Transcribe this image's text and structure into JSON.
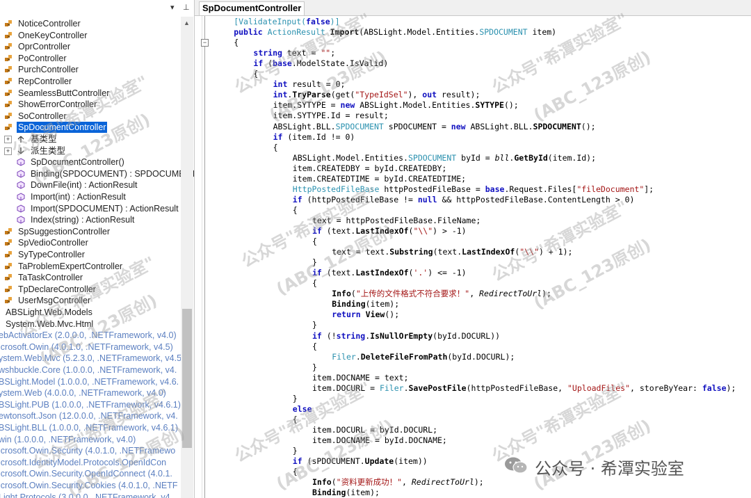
{
  "left_panel": {
    "toolbar": {
      "dropdown": "▾",
      "pin": "⊥"
    },
    "tree": [
      {
        "label": "NoticeController",
        "kind": "class",
        "indent": 0
      },
      {
        "label": "OneKeyController",
        "kind": "class",
        "indent": 0
      },
      {
        "label": "OprController",
        "kind": "class",
        "indent": 0
      },
      {
        "label": "PoController",
        "kind": "class",
        "indent": 0
      },
      {
        "label": "PurchController",
        "kind": "class",
        "indent": 0
      },
      {
        "label": "RepController",
        "kind": "class",
        "indent": 0
      },
      {
        "label": "SeamlessButtController",
        "kind": "class",
        "indent": 0
      },
      {
        "label": "ShowErrorController",
        "kind": "class",
        "indent": 0
      },
      {
        "label": "SoController",
        "kind": "class",
        "indent": 0
      },
      {
        "label": "SpDocumentController",
        "kind": "class",
        "indent": 0,
        "selected": true
      },
      {
        "label": "基类型",
        "kind": "base",
        "indent": 1
      },
      {
        "label": "派生类型",
        "kind": "derived",
        "indent": 1
      },
      {
        "label": "SpDocumentController()",
        "kind": "method",
        "indent": 1
      },
      {
        "label": "Binding(SPDOCUMENT) : SPDOCUMENT",
        "kind": "method",
        "indent": 1
      },
      {
        "label": "DownFile(int) : ActionResult",
        "kind": "method",
        "indent": 1
      },
      {
        "label": "Import(int) : ActionResult",
        "kind": "method",
        "indent": 1
      },
      {
        "label": "Import(SPDOCUMENT) : ActionResult",
        "kind": "method",
        "indent": 1
      },
      {
        "label": "Index(string) : ActionResult",
        "kind": "method",
        "indent": 1
      },
      {
        "label": "SpSuggestionController",
        "kind": "class",
        "indent": 0
      },
      {
        "label": "SpVedioController",
        "kind": "class",
        "indent": 0
      },
      {
        "label": "SyTypeController",
        "kind": "class",
        "indent": 0
      },
      {
        "label": "TaProblemExpertController",
        "kind": "class",
        "indent": 0
      },
      {
        "label": "TaTaskController",
        "kind": "class",
        "indent": 0
      },
      {
        "label": "TpDeclareController",
        "kind": "class",
        "indent": 0
      },
      {
        "label": "UserMsgController",
        "kind": "class",
        "indent": 0
      },
      {
        "label": "ABSLight.Web.Models",
        "kind": "ns",
        "indent": -1
      },
      {
        "label": "System.Web.Mvc.Html",
        "kind": "ns",
        "indent": -1
      },
      {
        "label": "ebActivatorEx (2.0.0.0, .NETFramework, v4.0)",
        "kind": "asm",
        "indent": -2
      },
      {
        "label": "icrosoft.Owin (4.0.1.0, .NETFramework, v4.5)",
        "kind": "asm",
        "indent": -2
      },
      {
        "label": "ystem.Web.Mvc (5.2.3.0, .NETFramework, v4.5",
        "kind": "asm",
        "indent": -2
      },
      {
        "label": "wshbuckle.Core (1.0.0.0, .NETFramework, v4.",
        "kind": "asm",
        "indent": -2
      },
      {
        "label": "BSLight.Model (1.0.0.0, .NETFramework, v4.6.",
        "kind": "asm",
        "indent": -2
      },
      {
        "label": "ystem.Web (4.0.0.0, .NETFramework, v4.0)",
        "kind": "asm",
        "indent": -2
      },
      {
        "label": "BSLight.PUB (1.0.0.0, .NETFramework, v4.6.1)",
        "kind": "asm",
        "indent": -2
      },
      {
        "label": "ewtonsoft.Json (12.0.0.0, .NETFramework, v4.",
        "kind": "asm",
        "indent": -2
      },
      {
        "label": "BSLight.BLL (1.0.0.0, .NETFramework, v4.6.1)",
        "kind": "asm",
        "indent": -2
      },
      {
        "label": "win (1.0.0.0, .NETFramework, v4.0)",
        "kind": "asm",
        "indent": -2
      },
      {
        "label": "icrosoft.Owin.Security (4.0.1.0, .NETFramewo",
        "kind": "asm",
        "indent": -2
      },
      {
        "label": "icrosoft.IdentityModel.Protocols.OpenIdCon",
        "kind": "asm",
        "indent": -2
      },
      {
        "label": "icrosoft.Owin.Security.OpenIdConnect (4.0.1.",
        "kind": "asm",
        "indent": -2
      },
      {
        "label": "icrosoft.Owin.Security.Cookies (4.0.1.0, .NETF",
        "kind": "asm",
        "indent": -2
      },
      {
        "label": "Light.Protocols (3.0.0.0, .NETFramework, v4.",
        "kind": "asm",
        "indent": -2
      }
    ]
  },
  "editor": {
    "tab_title": "SpDocumentController",
    "fold_toggle": "−",
    "lines": [
      {
        "indent": 4,
        "tokens": [
          [
            "at",
            "[ValidateInput("
          ],
          [
            "kw",
            "false"
          ],
          [
            "at",
            ")]"
          ]
        ]
      },
      {
        "indent": 4,
        "tokens": [
          [
            "kw",
            "public "
          ],
          [
            "ty",
            "ActionResult "
          ],
          [
            "mt",
            "Import"
          ],
          [
            "",
            "(ABSLight.Model.Entities."
          ],
          [
            "ty",
            "SPDOCUMENT"
          ],
          [
            "",
            " item)"
          ]
        ]
      },
      {
        "indent": 4,
        "tokens": [
          [
            "",
            "{"
          ]
        ]
      },
      {
        "indent": 8,
        "tokens": [
          [
            "kw",
            "string"
          ],
          [
            "",
            " text = "
          ],
          [
            "st",
            "\"\""
          ],
          [
            "",
            ";"
          ]
        ]
      },
      {
        "indent": 8,
        "tokens": [
          [
            "kw",
            "if"
          ],
          [
            "",
            " ("
          ],
          [
            "kw",
            "base"
          ],
          [
            "",
            ".ModelState.IsValid)"
          ]
        ]
      },
      {
        "indent": 8,
        "tokens": [
          [
            "",
            "{"
          ]
        ]
      },
      {
        "indent": 12,
        "tokens": [
          [
            "kw",
            "int"
          ],
          [
            "",
            " result = 0;"
          ]
        ]
      },
      {
        "indent": 12,
        "tokens": [
          [
            "kw",
            "int"
          ],
          [
            "",
            "."
          ],
          [
            "mt",
            "TryParse"
          ],
          [
            "",
            "(get("
          ],
          [
            "st",
            "\"TypeIdSel\""
          ],
          [
            "",
            "), "
          ],
          [
            "kw",
            "out"
          ],
          [
            "",
            " result);"
          ]
        ]
      },
      {
        "indent": 12,
        "tokens": [
          [
            "",
            "item.SYTYPE = "
          ],
          [
            "kw",
            "new"
          ],
          [
            "",
            " ABSLight.Model.Entities."
          ],
          [
            "mt",
            "SYTYPE"
          ],
          [
            "",
            "();"
          ]
        ]
      },
      {
        "indent": 12,
        "tokens": [
          [
            "",
            "item.SYTYPE.Id = result;"
          ]
        ]
      },
      {
        "indent": 12,
        "tokens": [
          [
            "",
            "ABSLight.BLL."
          ],
          [
            "ty",
            "SPDOCUMENT"
          ],
          [
            "",
            " sPDOCUMENT = "
          ],
          [
            "kw",
            "new"
          ],
          [
            "",
            " ABSLight.BLL."
          ],
          [
            "mt",
            "SPDOCUMENT"
          ],
          [
            "",
            "();"
          ]
        ]
      },
      {
        "indent": 12,
        "tokens": [
          [
            "kw",
            "if"
          ],
          [
            "",
            " (item.Id != 0)"
          ]
        ]
      },
      {
        "indent": 12,
        "tokens": [
          [
            "",
            "{"
          ]
        ]
      },
      {
        "indent": 16,
        "tokens": [
          [
            "",
            "ABSLight.Model.Entities."
          ],
          [
            "ty",
            "SPDOCUMENT"
          ],
          [
            "",
            " byId = "
          ],
          [
            "it",
            "bll"
          ],
          [
            "",
            "."
          ],
          [
            "mt",
            "GetById"
          ],
          [
            "",
            "(item.Id);"
          ]
        ]
      },
      {
        "indent": 16,
        "tokens": [
          [
            "",
            "item.CREATEDBY = byId.CREATEDBY;"
          ]
        ]
      },
      {
        "indent": 16,
        "tokens": [
          [
            "",
            "item.CREATEDTIME = byId.CREATEDTIME;"
          ]
        ]
      },
      {
        "indent": 16,
        "tokens": [
          [
            "ty",
            "HttpPostedFileBase"
          ],
          [
            "",
            " httpPostedFileBase = "
          ],
          [
            "kw",
            "base"
          ],
          [
            "",
            ".Request.Files["
          ],
          [
            "st",
            "\"fileDocument\""
          ],
          [
            "",
            "];"
          ]
        ]
      },
      {
        "indent": 16,
        "tokens": [
          [
            "kw",
            "if"
          ],
          [
            "",
            " (httpPostedFileBase != "
          ],
          [
            "kw",
            "null"
          ],
          [
            "",
            " && httpPostedFileBase.ContentLength > 0)"
          ]
        ]
      },
      {
        "indent": 16,
        "tokens": [
          [
            "",
            "{"
          ]
        ]
      },
      {
        "indent": 20,
        "tokens": [
          [
            "",
            "text = httpPostedFileBase.FileName;"
          ]
        ]
      },
      {
        "indent": 20,
        "tokens": [
          [
            "kw",
            "if"
          ],
          [
            "",
            " (text."
          ],
          [
            "mt",
            "LastIndexOf"
          ],
          [
            "",
            "("
          ],
          [
            "st",
            "\"\\\\\""
          ],
          [
            "",
            ") > -1)"
          ]
        ]
      },
      {
        "indent": 20,
        "tokens": [
          [
            "",
            "{"
          ]
        ]
      },
      {
        "indent": 24,
        "tokens": [
          [
            "",
            "text = text."
          ],
          [
            "mt",
            "Substring"
          ],
          [
            "",
            "(text."
          ],
          [
            "mt",
            "LastIndexOf"
          ],
          [
            "",
            "("
          ],
          [
            "st",
            "\"\\\\\""
          ],
          [
            "",
            ") + 1);"
          ]
        ]
      },
      {
        "indent": 20,
        "tokens": [
          [
            "",
            "}"
          ]
        ]
      },
      {
        "indent": 20,
        "tokens": [
          [
            "kw",
            "if"
          ],
          [
            "",
            " (text."
          ],
          [
            "mt",
            "LastIndexOf"
          ],
          [
            "",
            "("
          ],
          [
            "st",
            "'.'"
          ],
          [
            "",
            ") <= -1)"
          ]
        ]
      },
      {
        "indent": 20,
        "tokens": [
          [
            "",
            "{"
          ]
        ]
      },
      {
        "indent": 24,
        "tokens": [
          [
            "mt",
            "Info"
          ],
          [
            "",
            "("
          ],
          [
            "st",
            "\"上传的文件格式不符合要求！\""
          ],
          [
            "",
            ", "
          ],
          [
            "it",
            "RedirectToUrl"
          ],
          [
            "",
            ");"
          ]
        ]
      },
      {
        "indent": 24,
        "tokens": [
          [
            "mt",
            "Binding"
          ],
          [
            "",
            "(item);"
          ]
        ]
      },
      {
        "indent": 24,
        "tokens": [
          [
            "kw",
            "return "
          ],
          [
            "mt",
            "View"
          ],
          [
            "",
            "();"
          ]
        ]
      },
      {
        "indent": 20,
        "tokens": [
          [
            "",
            "}"
          ]
        ]
      },
      {
        "indent": 20,
        "tokens": [
          [
            "kw",
            "if"
          ],
          [
            "",
            " (!"
          ],
          [
            "kw",
            "string"
          ],
          [
            "",
            "."
          ],
          [
            "mt",
            "IsNullOrEmpty"
          ],
          [
            "",
            "(byId.DOCURL))"
          ]
        ]
      },
      {
        "indent": 20,
        "tokens": [
          [
            "",
            "{"
          ]
        ]
      },
      {
        "indent": 24,
        "tokens": [
          [
            "ty",
            "Filer"
          ],
          [
            "",
            "."
          ],
          [
            "mt",
            "DeleteFileFromPath"
          ],
          [
            "",
            "(byId.DOCURL);"
          ]
        ]
      },
      {
        "indent": 20,
        "tokens": [
          [
            "",
            "}"
          ]
        ]
      },
      {
        "indent": 20,
        "tokens": [
          [
            "",
            "item.DOCNAME = text;"
          ]
        ]
      },
      {
        "indent": 20,
        "tokens": [
          [
            "",
            "item.DOCURL = "
          ],
          [
            "ty",
            "Filer"
          ],
          [
            "",
            "."
          ],
          [
            "mt",
            "SavePostFile"
          ],
          [
            "",
            "(httpPostedFileBase, "
          ],
          [
            "st",
            "\"UploadFiles\""
          ],
          [
            "",
            ", storeByYear: "
          ],
          [
            "kw",
            "false"
          ],
          [
            "",
            ");"
          ]
        ]
      },
      {
        "indent": 16,
        "tokens": [
          [
            "",
            "}"
          ]
        ]
      },
      {
        "indent": 16,
        "tokens": [
          [
            "kw",
            "else"
          ]
        ]
      },
      {
        "indent": 16,
        "tokens": [
          [
            "",
            "{"
          ]
        ]
      },
      {
        "indent": 20,
        "tokens": [
          [
            "",
            "item.DOCURL = byId.DOCURL;"
          ]
        ]
      },
      {
        "indent": 20,
        "tokens": [
          [
            "",
            "item.DOCNAME = byId.DOCNAME;"
          ]
        ]
      },
      {
        "indent": 16,
        "tokens": [
          [
            "",
            "}"
          ]
        ]
      },
      {
        "indent": 16,
        "tokens": [
          [
            "kw",
            "if"
          ],
          [
            "",
            " (sPDOCUMENT."
          ],
          [
            "mt",
            "Update"
          ],
          [
            "",
            "(item))"
          ]
        ]
      },
      {
        "indent": 16,
        "tokens": [
          [
            "",
            "{"
          ]
        ]
      },
      {
        "indent": 20,
        "tokens": [
          [
            "mt",
            "Info"
          ],
          [
            "",
            "("
          ],
          [
            "st",
            "\"资料更新成功！\""
          ],
          [
            "",
            ", "
          ],
          [
            "it",
            "RedirectToUrl"
          ],
          [
            "",
            ");"
          ]
        ]
      },
      {
        "indent": 20,
        "tokens": [
          [
            "mt",
            "Binding"
          ],
          [
            "",
            "(item);"
          ]
        ]
      }
    ]
  },
  "watermarks": [
    {
      "text": "公众号\"希潭实验室\""
    },
    {
      "text": "(ABC_123原创)"
    }
  ],
  "brand": {
    "text": "公众号 · 希潭实验室",
    "icon": "wechat-icon"
  },
  "colors": {
    "selection": "#0a64d8",
    "keyword": "#1010c0",
    "type": "#2b91af",
    "string": "#a31515"
  }
}
